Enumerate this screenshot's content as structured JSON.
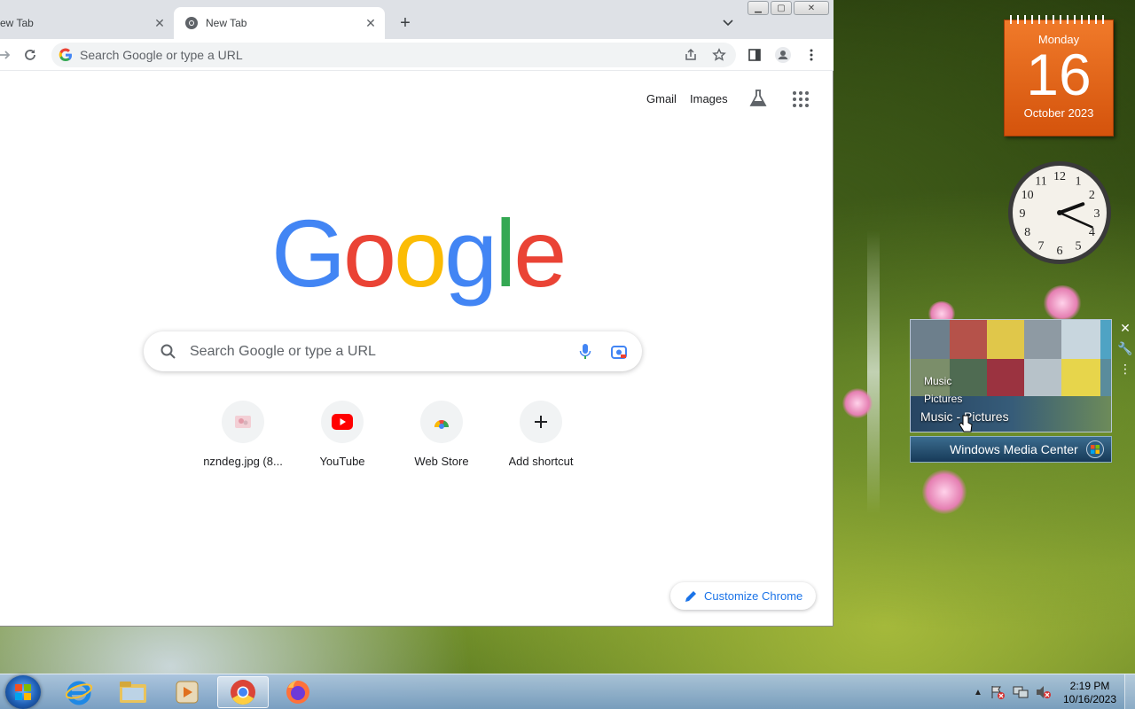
{
  "browser": {
    "tabs": [
      {
        "title": "ew Tab",
        "active": false
      },
      {
        "title": "New Tab",
        "active": true
      }
    ],
    "omnibox_placeholder": "Search Google or type a URL"
  },
  "ntp": {
    "links": {
      "gmail": "Gmail",
      "images": "Images"
    },
    "logo_letters": [
      {
        "ch": "G",
        "color": "#4285f4"
      },
      {
        "ch": "o",
        "color": "#ea4335"
      },
      {
        "ch": "o",
        "color": "#fbbc05"
      },
      {
        "ch": "g",
        "color": "#4285f4"
      },
      {
        "ch": "l",
        "color": "#34a853"
      },
      {
        "ch": "e",
        "color": "#ea4335"
      }
    ],
    "search_placeholder": "Search Google or type a URL",
    "shortcuts": [
      {
        "label": "nzndeg.jpg (8..."
      },
      {
        "label": "YouTube"
      },
      {
        "label": "Web Store"
      },
      {
        "label": "Add shortcut"
      }
    ],
    "customize_label": "Customize Chrome"
  },
  "gadgets": {
    "calendar": {
      "day": "Monday",
      "date": "16",
      "month": "October 2023"
    },
    "clock": {
      "hour": 2,
      "minute": 19,
      "numerals": [
        "12",
        "1",
        "2",
        "3",
        "4",
        "5",
        "6",
        "7",
        "8",
        "9",
        "10",
        "11"
      ]
    },
    "media_center": {
      "menu": [
        "Music",
        "Pictures"
      ],
      "breadcrumb": "Music - Pictures",
      "brand": "Windows Media Center"
    }
  },
  "taskbar": {
    "time": "2:19 PM",
    "date": "10/16/2023"
  },
  "colors": {
    "accent": "#1a73e8",
    "calendar": "#e8661e",
    "taskbar": "#9bb8d6"
  }
}
